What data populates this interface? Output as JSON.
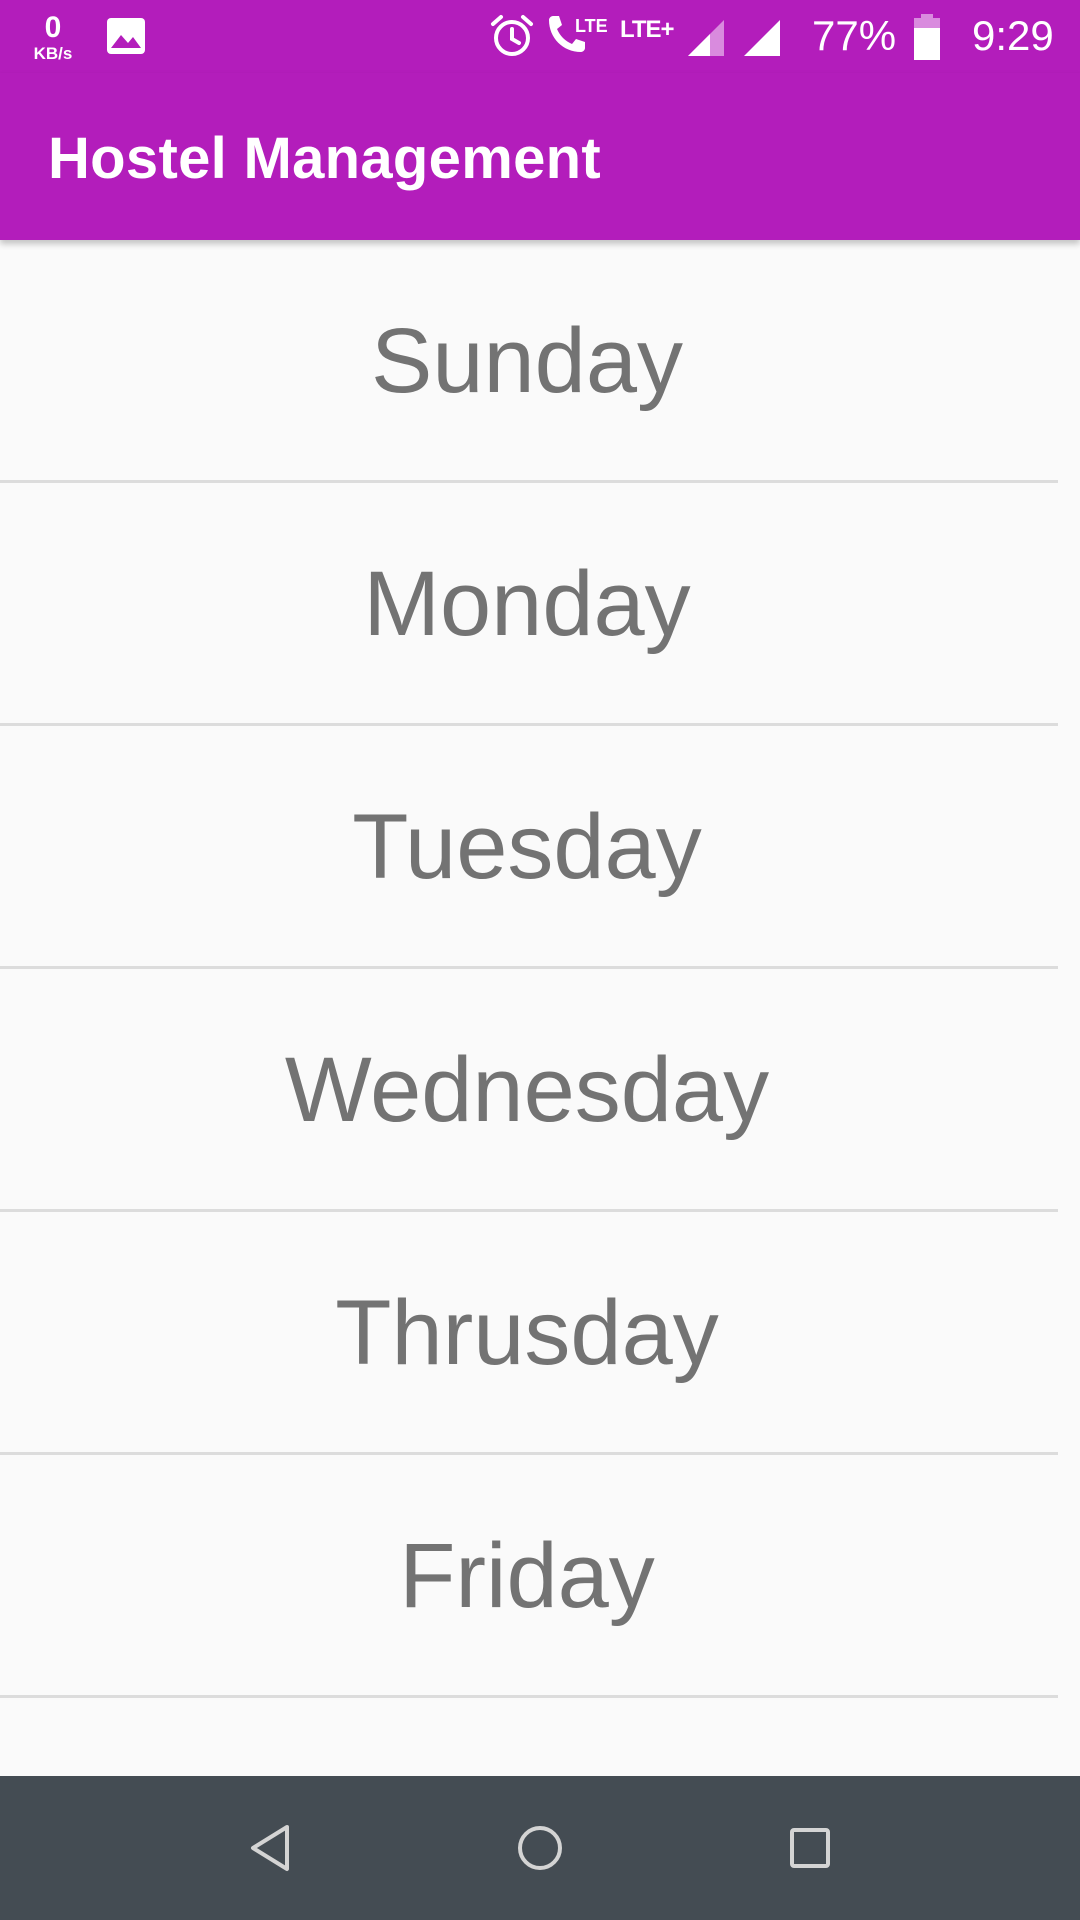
{
  "status_bar": {
    "net_speed_value": "0",
    "net_speed_unit": "KB/s",
    "network_label": "LTE+",
    "call_label": "LTE",
    "battery_percent": "77%",
    "time": "9:29",
    "icons": [
      "gallery-icon",
      "alarm-icon",
      "volte-call-icon",
      "signal-icon",
      "signal-icon",
      "battery-icon"
    ]
  },
  "app_bar": {
    "title": "Hostel Management",
    "color": "#b31dbb"
  },
  "days": [
    {
      "label": "Sunday"
    },
    {
      "label": "Monday"
    },
    {
      "label": "Tuesday"
    },
    {
      "label": "Wednesday"
    },
    {
      "label": "Thrusday"
    },
    {
      "label": "Friday"
    },
    {
      "label": ""
    }
  ],
  "nav_bar": {
    "icons": [
      "back-icon",
      "home-icon",
      "recents-icon"
    ],
    "color": "#444c53"
  }
}
